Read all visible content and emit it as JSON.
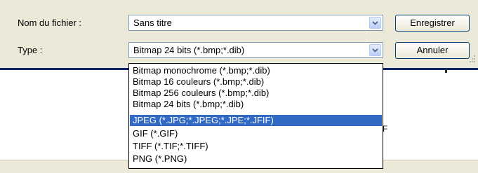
{
  "dialog": {
    "filename_label": "Nom du fichier :",
    "type_label": "Type :",
    "filename_value": "Sans titre",
    "type_value": "Bitmap 24 bits (*.bmp;*.dib)",
    "save_button": "Enregistrer",
    "cancel_button": "Annuler"
  },
  "type_options": [
    "Bitmap monochrome (*.bmp;*.dib)",
    "Bitmap 16 couleurs (*.bmp;*.dib)",
    "Bitmap 256 couleurs (*.bmp;*.dib)",
    "Bitmap 24 bits (*.bmp;*.dib)",
    "JPEG (*.JPG;*.JPEG;*.JPE;*.JFIF)",
    "GIF (*.GIF)",
    "TIFF (*.TIF;*.TIFF)",
    "PNG (*.PNG)"
  ],
  "selected_option": "JPEG (*.JPG;*.JPEG;*.JPE;*.JFIF)",
  "background_fragment": "F",
  "colors": {
    "dialog_bg": "#ece9d8",
    "selection": "#316ac5",
    "field_border": "#7f9db9",
    "button_border": "#003c74"
  },
  "icons": [
    "chevron-down-icon",
    "resize-grip-icon"
  ]
}
